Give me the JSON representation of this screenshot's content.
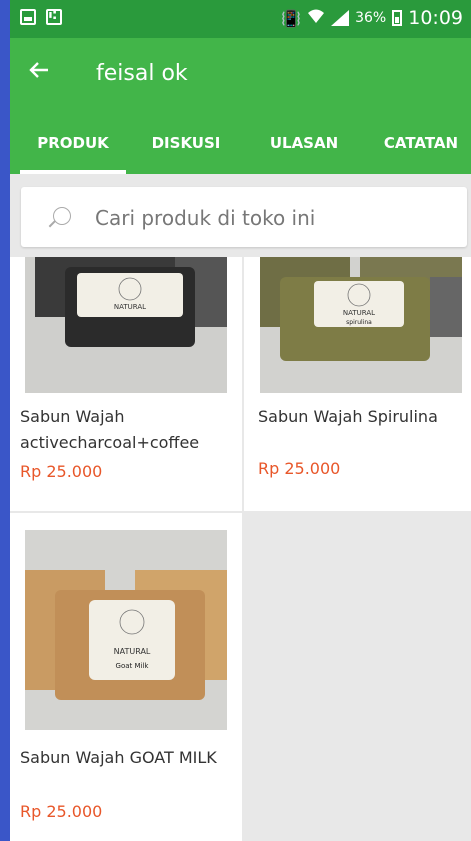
{
  "status_bar": {
    "battery_pct": "36%",
    "time": "10:09",
    "icons": [
      "image-icon",
      "usb-icon",
      "vibrate-icon",
      "wifi-icon",
      "signal-icon",
      "battery-charging-icon"
    ]
  },
  "appbar": {
    "back_icon": "arrow-left-icon",
    "title": "feisal ok"
  },
  "tabs": [
    {
      "label": "PRODUK",
      "active": true
    },
    {
      "label": "DISKUSI",
      "active": false
    },
    {
      "label": "ULASAN",
      "active": false
    },
    {
      "label": "CATATAN",
      "active": false
    }
  ],
  "search": {
    "placeholder": "Cari produk di toko ini",
    "value": ""
  },
  "products": [
    {
      "name": "Sabun Wajah activecharcoal+coffee",
      "price": "Rp 25.000",
      "image_label": "NATURAL"
    },
    {
      "name": "Sabun Wajah Spirulina",
      "price": "Rp 25.000",
      "image_label": "NATURAL",
      "image_sublabel": "spirulina"
    },
    {
      "name": "Sabun Wajah GOAT MILK",
      "price": "Rp 25.000",
      "image_label": "NATURAL",
      "image_sublabel": "Goat Milk"
    }
  ],
  "colors": {
    "statusbar": "#2a9a3c",
    "appbar": "#42b549",
    "price": "#e8572a",
    "background": "#e8e8e8"
  }
}
